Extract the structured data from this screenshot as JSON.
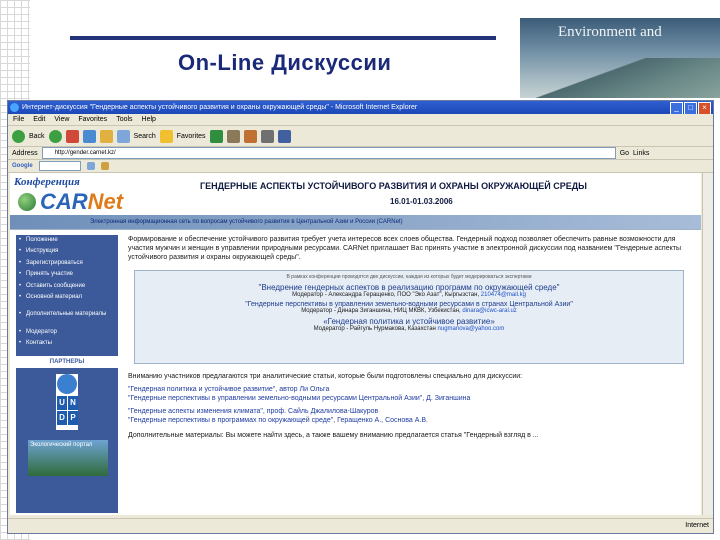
{
  "slide": {
    "title": "On-Line Дискуссии",
    "banner_text": "Environment and"
  },
  "browser": {
    "window_title": "Интернет-дискуссия \"Гендерные аспекты устойчивого развития и охраны окружающей среды\" - Microsoft Internet Explorer",
    "menu": [
      "File",
      "Edit",
      "View",
      "Favorites",
      "Tools",
      "Help"
    ],
    "toolbar": {
      "back": "Back",
      "search": "Search",
      "favorites": "Favorites"
    },
    "address_label": "Address",
    "address_value": "http://gender.carnet.kz/",
    "go_label": "Go",
    "links_label": "Links",
    "statusbar_text": "",
    "status_zone": "Internet"
  },
  "site": {
    "logo_top": "Конференция",
    "logo_main_1": "CAR",
    "logo_main_2": "Net",
    "title": "ГЕНДЕРНЫЕ АСПЕКТЫ УСТОЙЧИВОГО РАЗВИТИЯ И ОХРАНЫ ОКРУЖАЮЩЕЙ СРЕДЫ",
    "dates": "16.01-01.03.2006",
    "subtitle": "Электронная информационная сеть по вопросам устойчивого развития в Центральной Азии и России (CARNet)",
    "nav": [
      "Положение",
      "Инструкция",
      "Зарегистрироваться",
      "Принять участие",
      "Оставить сообщение",
      "Основной материал"
    ],
    "nav_ext": [
      "Дополнительные материалы"
    ],
    "nav_more": [
      "Модератор",
      "Контакты"
    ],
    "partners_label": "ПАРТНЕРЫ",
    "undp": [
      "U",
      "N",
      "D",
      "P"
    ],
    "eco_banner": "Экологический портал",
    "intro": "Формирование и обеспечение устойчивого развития требует учета интересов всех слоев общества. Гендерный подход позволяет обеспечить равные возможности для участия мужчин и женщин в управлении природными ресурсами. CARNet приглашает Вас принять участие в электронной дискуссии под названием \"Гендерные аспекты устойчивого развития и охраны окружающей среды\".",
    "disc_note": "В рамках конференции проводятся две дискуссии, каждая из которых будет модерироваться экспертами",
    "topic_1": "\"Внедрение гендерных аспектов в реализацию программ по окружающей среде\"",
    "mod_1": "Модератор - Александра Геращенко, ПОО \"Эко Азат\", Кыргызстан,",
    "mail_1": "210474@mail.kg",
    "topic_2": "\"Гендерные перспективы в управлении земельно-водными ресурсами в странах Центральной Азии\"",
    "mod_2": "Модератор - Динара Зиганшина, НИЦ МКВК, Узбекистан,",
    "mail_2": "dinara@icwc-aral.uz",
    "topic_3": "«Гендерная политика и устойчивое развитие»",
    "mod_3": "Модератор - Райгуль Нурмакова, Казахстан",
    "mail_3": "nugmanova@yahoo.com",
    "attention": "Вниманию участников предлагаются три аналитические статьи, которые были подготовлены специально для дискуссии:",
    "articles": [
      "\"Гендерная политика и устойчивое развитие\", автор Ли Ольга",
      "\"Гендерные перспективы в управлении земельно-водными ресурсами Центральной Азии\", Д. Зиганшина",
      "\"Гендерные аспекты изменения климата\", проф. Сайль Джалилова-Шакуров",
      "\"Гендерные перспективы в программах по окружающей среде\", Геращенко А., Соснова А.В."
    ],
    "extra": "Дополнительные материалы: Вы можете найти здесь, а также вашему вниманию предлагается статья \"Гендерный взгляд в ..."
  }
}
